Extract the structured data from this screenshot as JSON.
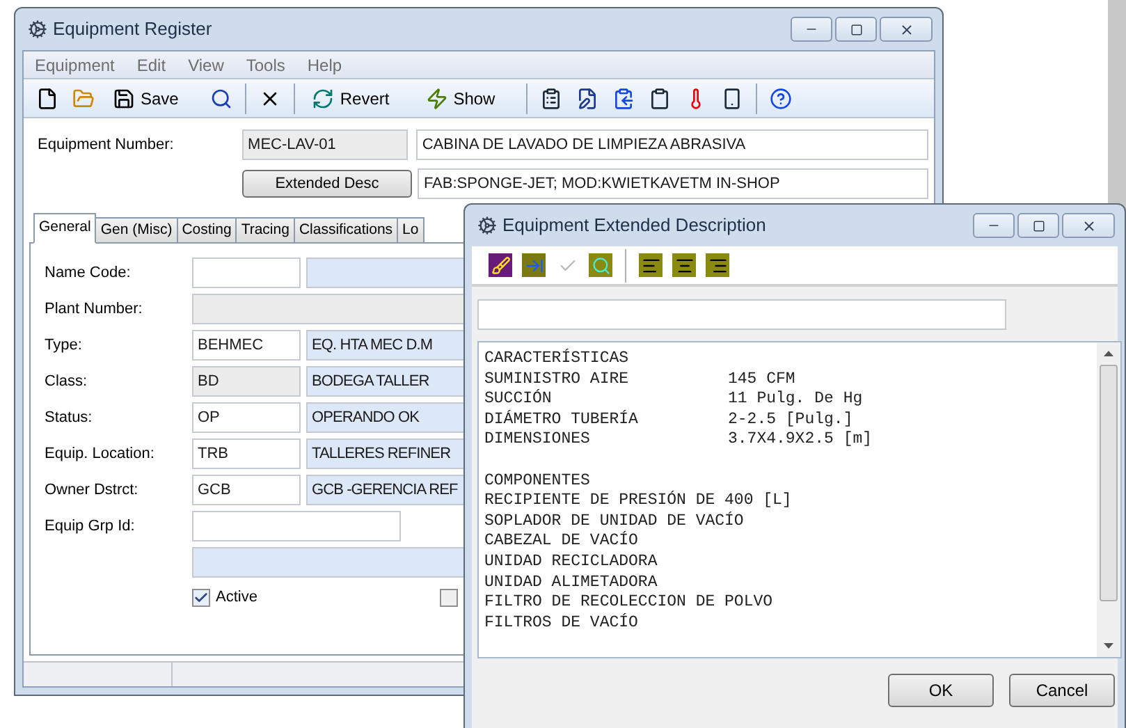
{
  "main_window": {
    "title": "Equipment Register",
    "menu": [
      "Equipment",
      "Edit",
      "View",
      "Tools",
      "Help"
    ],
    "toolbar": [
      {
        "kind": "icon"
      },
      {
        "kind": "icon"
      },
      {
        "kind": "labeled",
        "label": "Save"
      },
      {
        "kind": "icon"
      },
      {
        "kind": "separator"
      },
      {
        "kind": "icon"
      },
      {
        "kind": "separator"
      },
      {
        "kind": "labeled",
        "label": "Revert"
      },
      {
        "kind": "labeled",
        "label": "Show"
      },
      {
        "kind": "separator"
      },
      {
        "kind": "icon"
      },
      {
        "kind": "icon"
      },
      {
        "kind": "icon"
      },
      {
        "kind": "icon"
      },
      {
        "kind": "icon"
      },
      {
        "kind": "icon"
      },
      {
        "kind": "separator"
      },
      {
        "kind": "icon"
      }
    ],
    "equipment_number": {
      "label": "Equipment Number:",
      "value": "MEC-LAV-01",
      "description": "CABINA DE LAVADO DE LIMPIEZA ABRASIVA"
    },
    "extended_desc": {
      "button": "Extended Desc",
      "value": "FAB:SPONGE-JET; MOD:KWIETKAVETM IN-SHOP"
    },
    "tabs": [
      {
        "label": "General",
        "selected": true
      },
      {
        "label": "Gen (Misc)",
        "selected": false
      },
      {
        "label": "Costing",
        "selected": false
      },
      {
        "label": "Tracing",
        "selected": false
      },
      {
        "label": "Classifications",
        "selected": false
      },
      {
        "label": "Lo",
        "selected": false
      }
    ],
    "rows": [
      {
        "kind": "pair",
        "label": "Name Code:",
        "readonly": false
      },
      {
        "kind": "disabled",
        "label": "Plant Number:"
      },
      {
        "kind": "pair",
        "label": "Type:",
        "code": "BEHMEC",
        "description": "EQ. HTA MEC  D.M",
        "readonly": false
      },
      {
        "kind": "pair",
        "label": "Class:",
        "code": "BD",
        "description": "BODEGA TALLER",
        "readonly": true
      },
      {
        "kind": "pair",
        "label": "Status:",
        "code": "OP",
        "description": "OPERANDO OK",
        "readonly": false
      },
      {
        "kind": "pair",
        "label": "Equip. Location:",
        "code": "TRB",
        "description": "TALLERES REFINER",
        "readonly": false
      },
      {
        "kind": "pair",
        "label": "Owner Dstrct:",
        "code": "GCB",
        "description": "GCB -GERENCIA REF",
        "readonly": false
      },
      {
        "kind": "text",
        "label": "Equip Grp Id:"
      },
      {
        "kind": "lookup"
      }
    ],
    "checkboxes": [
      {
        "label": "Active",
        "checked": true
      },
      {
        "checked": false
      }
    ]
  },
  "dialog": {
    "title": "Equipment Extended Description",
    "toolbar": [
      {
        "kind": "icon",
        "disabled": false
      },
      {
        "kind": "icon",
        "disabled": false
      },
      {
        "kind": "icon",
        "disabled": true
      },
      {
        "kind": "icon",
        "disabled": false
      },
      {
        "kind": "separator"
      },
      {
        "kind": "icon",
        "disabled": false
      },
      {
        "kind": "icon",
        "disabled": false
      },
      {
        "kind": "icon",
        "disabled": false
      }
    ],
    "sections": [
      {
        "heading": "CARACTERÍSTICAS",
        "lines": [
          {
            "name": "SUMINISTRO AIRE",
            "value": "145 CFM"
          },
          {
            "name": "SUCCIÓN",
            "value": "11 Pulg. De Hg"
          },
          {
            "name": "DIÁMETRO TUBERÍA",
            "value": "2-2.5 [Pulg.]"
          },
          {
            "name": "DIMENSIONES",
            "value": "3.7X4.9X2.5 [m]"
          }
        ]
      },
      {
        "heading": "COMPONENTES",
        "lines": [
          {
            "name": "RECIPIENTE DE PRESIÓN DE 400 [L]"
          },
          {
            "name": "SOPLADOR DE UNIDAD DE VACÍO"
          },
          {
            "name": "CABEZAL DE VACÍO"
          },
          {
            "name": "UNIDAD RECICLADORA"
          },
          {
            "name": "UNIDAD ALIMETADORA"
          },
          {
            "name": "FILTRO DE RECOLECCION DE POLVO"
          },
          {
            "name": "FILTROS DE VACÍO"
          }
        ]
      }
    ],
    "buttons": [
      "OK",
      "Cancel"
    ]
  }
}
